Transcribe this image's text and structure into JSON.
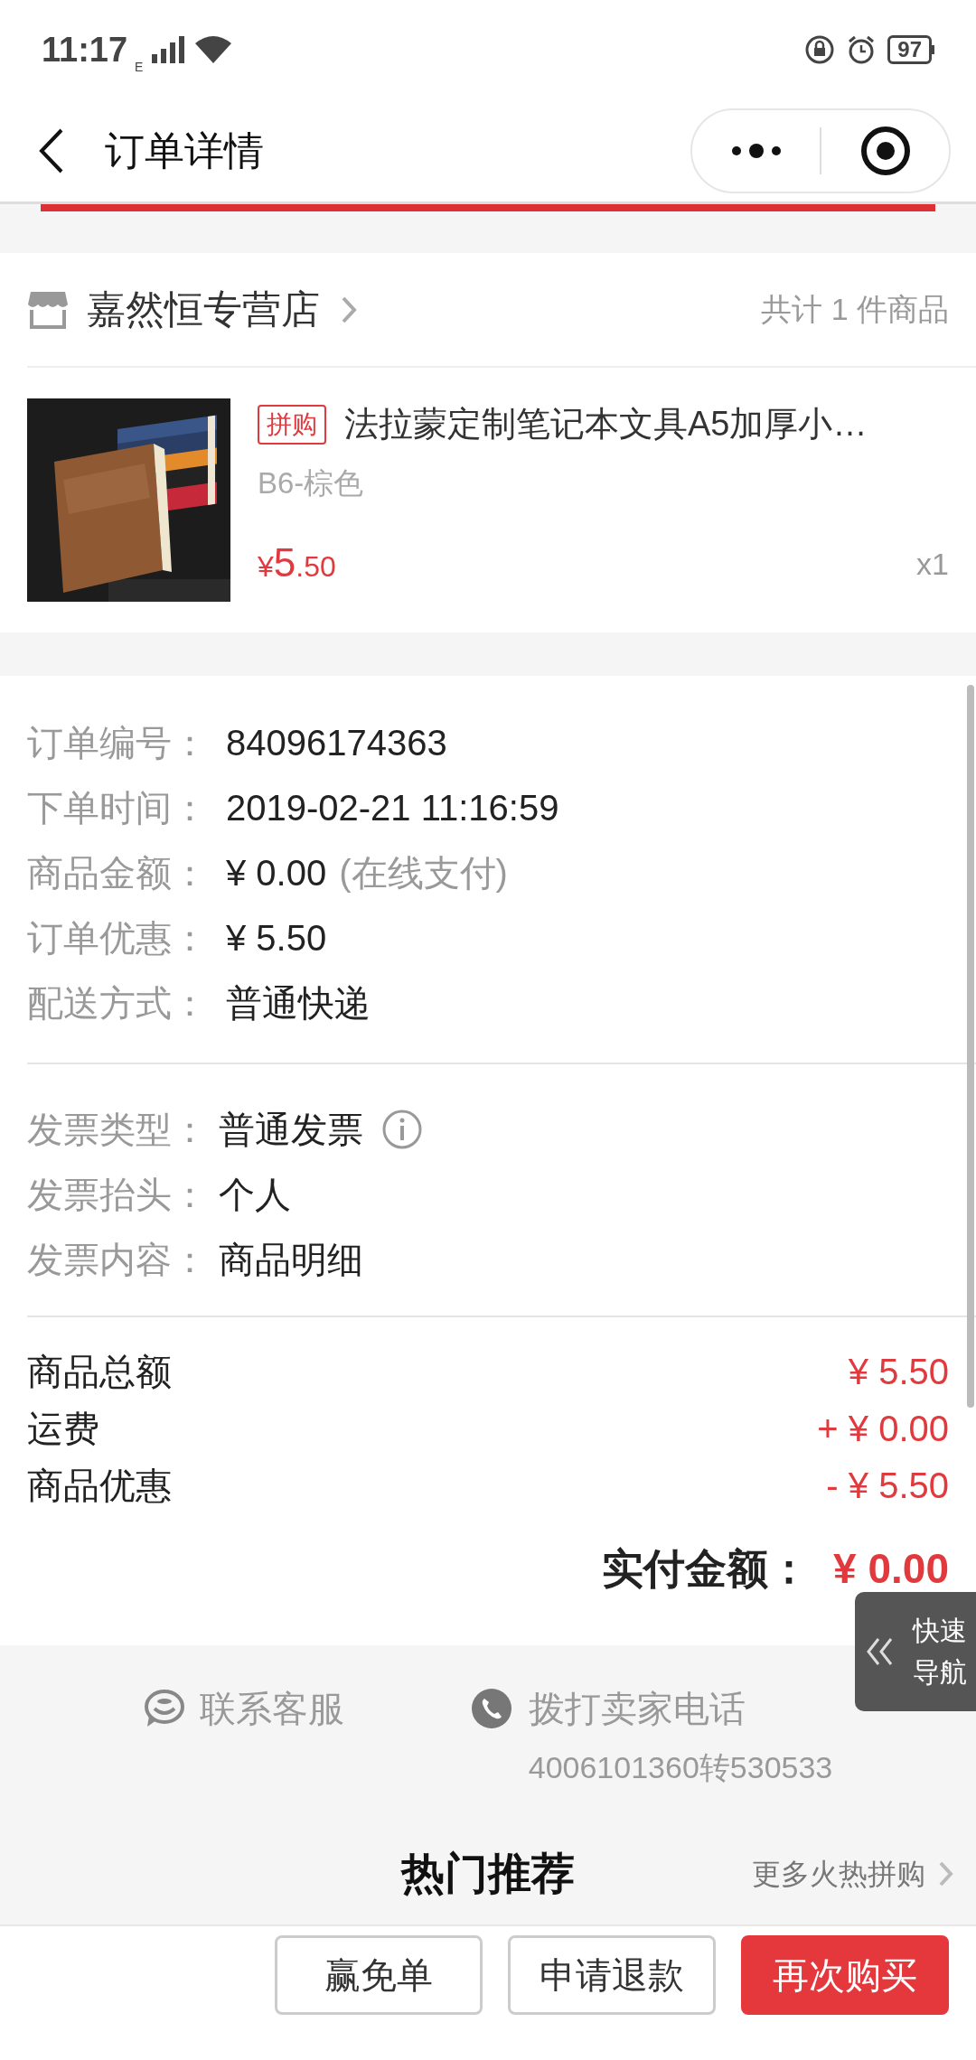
{
  "status_bar": {
    "time": "11:17",
    "network": "E",
    "battery": "97"
  },
  "nav": {
    "title": "订单详情"
  },
  "store": {
    "name": "嘉然恒专营店",
    "count": "共计 1 件商品"
  },
  "product": {
    "tag": "拼购",
    "title": "法拉蒙定制笔记本文具A5加厚小…",
    "spec": "B6-棕色",
    "price_symbol": "¥",
    "price_int": "5",
    "price_dec": ".50",
    "qty": "x1"
  },
  "order_info": [
    {
      "label": "订单编号：",
      "value": "84096174363"
    },
    {
      "label": "下单时间：",
      "value": "2019-02-21 11:16:59"
    },
    {
      "label": "商品金额：",
      "value": "¥ 0.00",
      "note": "(在线支付)"
    },
    {
      "label": "订单优惠：",
      "value": "¥ 5.50"
    },
    {
      "label": "配送方式：",
      "value": "普通快递"
    }
  ],
  "invoice": [
    {
      "label": "发票类型：",
      "value": "普通发票",
      "info": true
    },
    {
      "label": "发票抬头：",
      "value": "个人",
      "info": false
    },
    {
      "label": "发票内容：",
      "value": "商品明细",
      "info": false
    }
  ],
  "totals": [
    {
      "label": "商品总额",
      "value": "¥ 5.50"
    },
    {
      "label": "运费",
      "value": "+ ¥ 0.00"
    },
    {
      "label": "商品优惠",
      "value": "- ¥ 5.50"
    }
  ],
  "paid": {
    "label": "实付金额：",
    "value": "¥ 0.00"
  },
  "contact": {
    "service": "联系客服",
    "call": "拨打卖家电话",
    "phone": "4006101360转530533"
  },
  "hot": {
    "title": "热门推荐",
    "more": "更多火热拼购"
  },
  "quick_nav": {
    "label": "快速导航"
  },
  "buttons": [
    {
      "label": "赢免单",
      "kind": "outline"
    },
    {
      "label": "申请退款",
      "kind": "outline"
    },
    {
      "label": "再次购买",
      "kind": "primary"
    }
  ]
}
